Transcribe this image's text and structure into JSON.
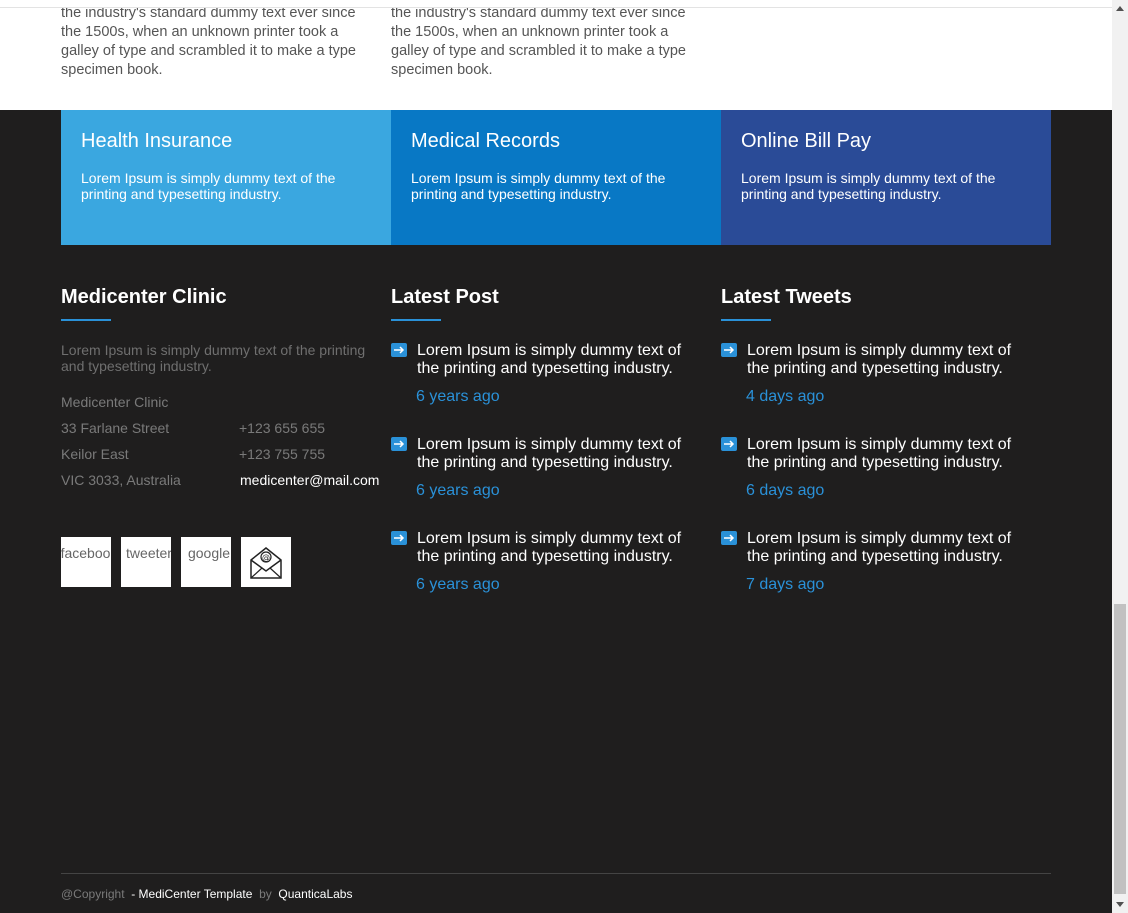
{
  "intro": {
    "col1": "the industry's standard dummy text ever since the 1500s, when an unknown printer took a galley of type and scrambled it to make a type specimen book.",
    "col2": "the industry's standard dummy text ever since the 1500s, when an unknown printer took a galley of type and scrambled it to make a type specimen book."
  },
  "features": [
    {
      "title": "Health Insurance",
      "text": "Lorem Ipsum is simply dummy text of the printing and typesetting industry.",
      "color": "#3aa7e0"
    },
    {
      "title": "Medical Records",
      "text": "Lorem Ipsum is simply dummy text of the printing and typesetting industry.",
      "color": "#0878c5"
    },
    {
      "title": "Online Bill Pay",
      "text": "Lorem Ipsum is simply dummy text of the printing and typesetting industry.",
      "color": "#2a4b97"
    }
  ],
  "about": {
    "title": "Medicenter Clinic",
    "text": "Lorem Ipsum is simply dummy text of the printing and typesetting industry.",
    "address": [
      "Medicenter Clinic",
      "33 Farlane Street",
      "Keilor East",
      "VIC 3033, Australia"
    ],
    "phone1": "+123 655 655",
    "phone2": "+123 755 755",
    "email": "medicenter@mail.com"
  },
  "social": [
    {
      "alt": "facebook",
      "icon": "facebook-icon"
    },
    {
      "alt": "tweeter",
      "icon": "twitter-icon"
    },
    {
      "alt": "google",
      "icon": "google-icon"
    },
    {
      "alt": "",
      "icon": "mail-icon"
    }
  ],
  "latest_post": {
    "title": "Latest Post",
    "items": [
      {
        "text": "Lorem Ipsum is simply dummy text of the printing and typesetting industry.",
        "time": "6 years ago"
      },
      {
        "text": "Lorem Ipsum is simply dummy text of the printing and typesetting industry.",
        "time": "6 years ago"
      },
      {
        "text": "Lorem Ipsum is simply dummy text of the printing and typesetting industry.",
        "time": "6 years ago"
      }
    ]
  },
  "latest_tweets": {
    "title": "Latest Tweets",
    "items": [
      {
        "text": "Lorem Ipsum is simply dummy text of the printing and typesetting industry.",
        "time": "4 days ago"
      },
      {
        "text": "Lorem Ipsum is simply dummy text of the printing and typesetting industry.",
        "time": "6 days ago"
      },
      {
        "text": "Lorem Ipsum is simply dummy text of the printing and typesetting industry.",
        "time": "7 days ago"
      }
    ]
  },
  "footer": {
    "copyright": "@Copyright",
    "template_link": "- MediCenter Template",
    "by": "by",
    "author_link": "QuanticaLabs"
  },
  "colors": {
    "accent": "#2a91d8",
    "background": "#1f1e1e"
  }
}
